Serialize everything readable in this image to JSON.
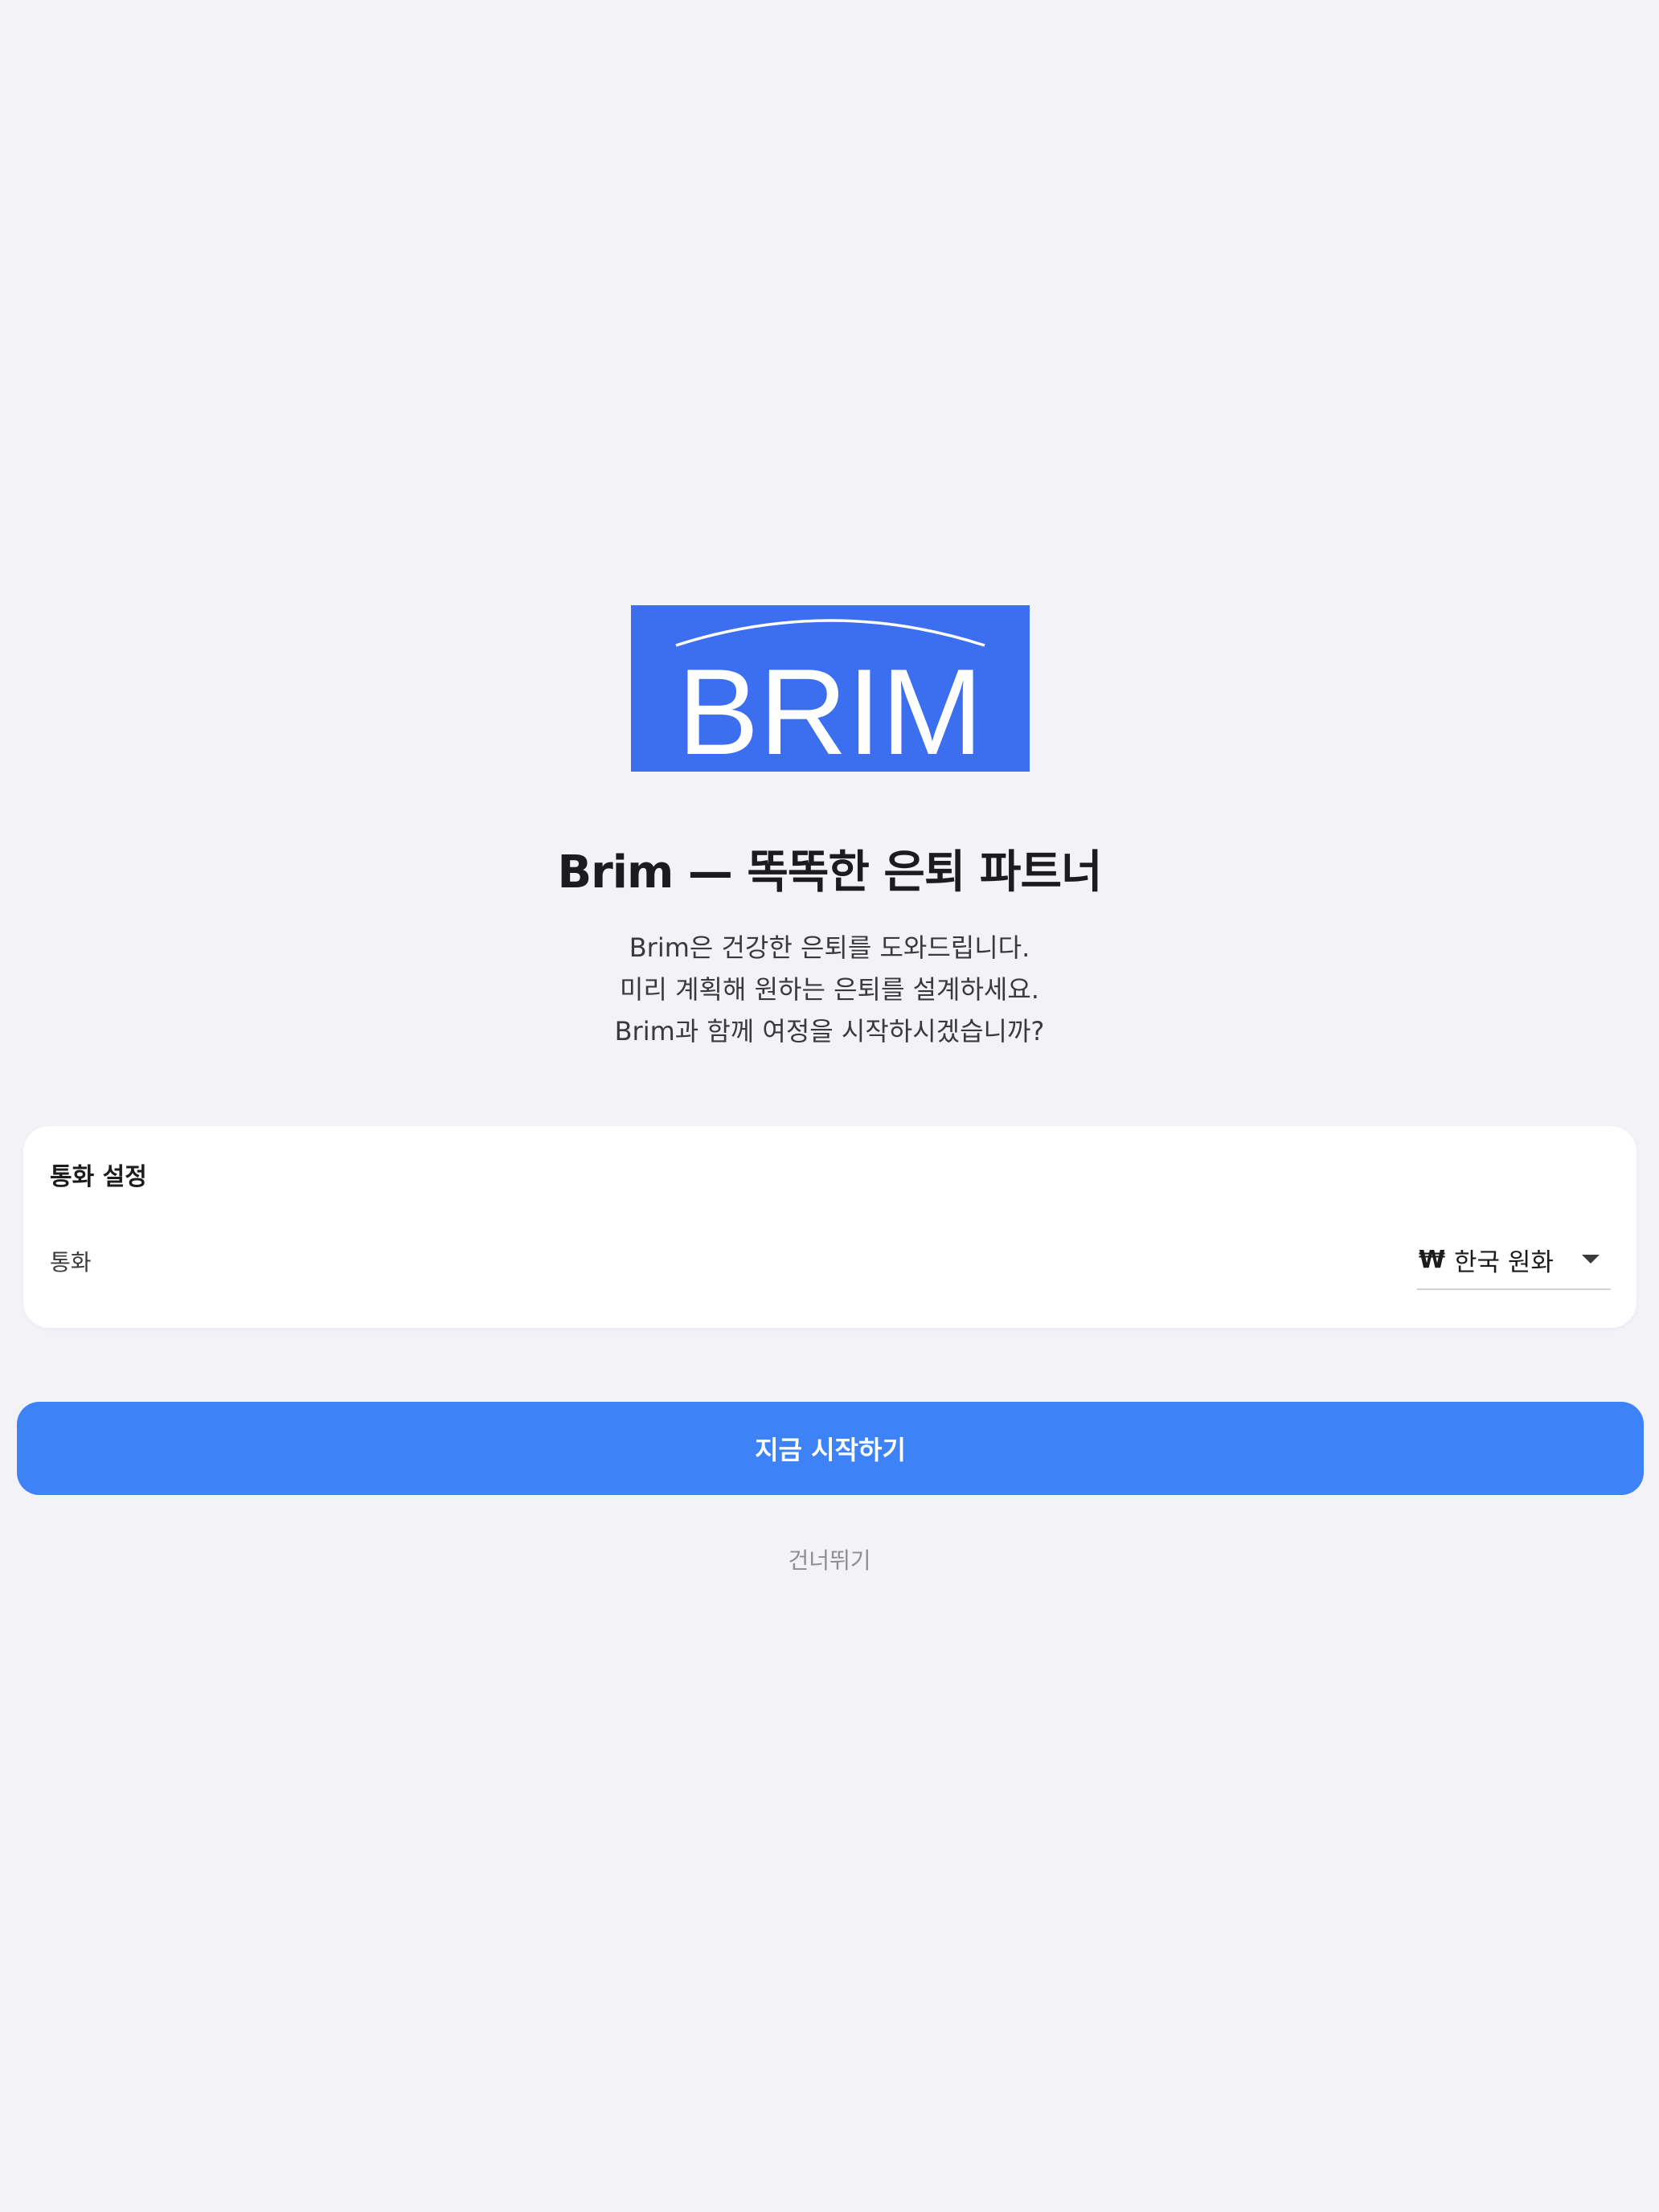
{
  "logo": {
    "text": "BRIM",
    "background_color": "#3b6ff0"
  },
  "headline": "Brim — 똑똑한 은퇴 파트너",
  "intro": {
    "lines": [
      "Brim은 건강한 은퇴를 도와드립니다.",
      "미리 계획해 원하는 은퇴를 설계하세요.",
      "Brim과 함께 여정을 시작하시겠습니까?"
    ]
  },
  "currency_settings": {
    "title": "통화 설정",
    "label": "통화",
    "selected": {
      "symbol": "₩",
      "name": "한국 원화"
    },
    "dropdown_icon": "chevron-down-icon"
  },
  "start_button": {
    "label": "지금 시작하기",
    "color": "#3d82f6"
  },
  "skip_link": {
    "label": "건너뛰기"
  }
}
